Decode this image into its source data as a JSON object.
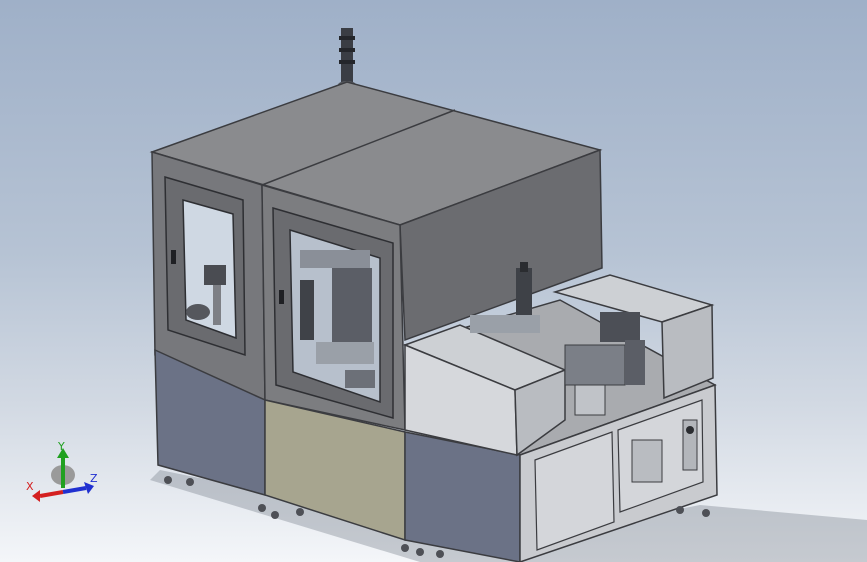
{
  "viewport": {
    "background_top": "#9fb0c8",
    "background_bottom": "#f4f6f9"
  },
  "machine": {
    "body_color": "#7c7d80",
    "roof_color": "#8a8b8e",
    "side_color": "#5f6063",
    "lower_panel_color": "#6b7286",
    "beige_panel_color": "#a7a58f",
    "window_tint": "#cfd8e3"
  },
  "triad": {
    "x_label": "X",
    "y_label": "Y",
    "z_label": "Z",
    "x_color": "#d42020",
    "y_color": "#20a020",
    "z_color": "#2030d0"
  }
}
